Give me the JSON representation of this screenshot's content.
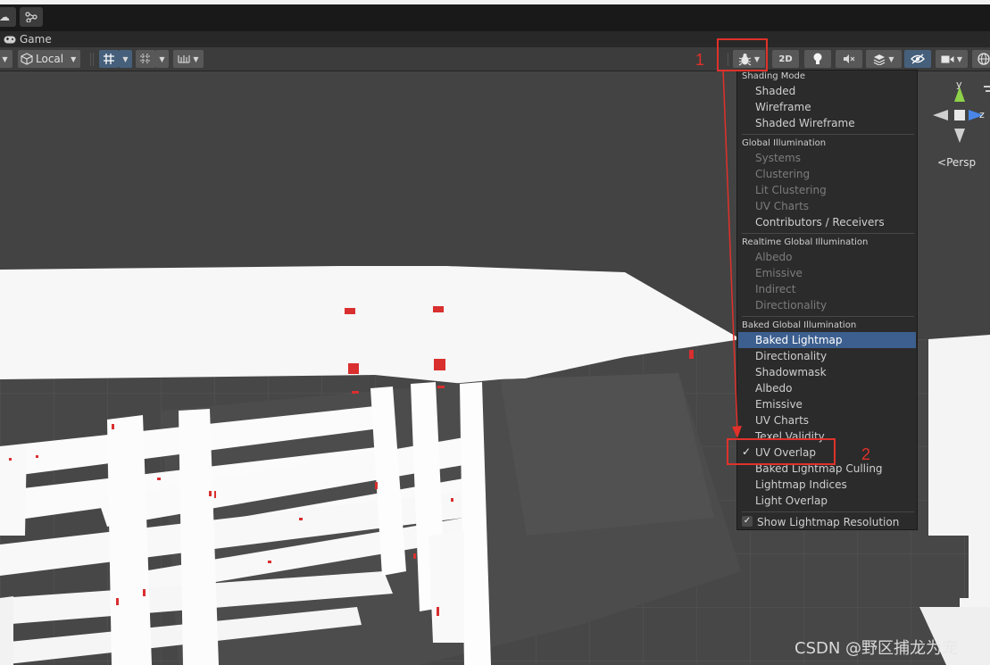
{
  "window": {
    "tab_label": "Game"
  },
  "toolbar": {
    "pivot_rotation": "Local",
    "twod_label": "2D"
  },
  "scene": {
    "projection_label": "Persp",
    "gizmo_axes": {
      "y": "y",
      "z": "z"
    }
  },
  "draw_mode_menu": {
    "sections": {
      "shading_mode": "Shading Mode",
      "global_illumination": "Global Illumination",
      "realtime_gi": "Realtime Global Illumination",
      "baked_gi": "Baked Global Illumination"
    },
    "shading_items": [
      "Shaded",
      "Wireframe",
      "Shaded Wireframe"
    ],
    "gi_items": [
      "Systems",
      "Clustering",
      "Lit Clustering",
      "UV Charts",
      "Contributors / Receivers"
    ],
    "realtime_items": [
      "Albedo",
      "Emissive",
      "Indirect",
      "Directionality"
    ],
    "baked_items": [
      "Baked Lightmap",
      "Directionality",
      "Shadowmask",
      "Albedo",
      "Emissive",
      "UV Charts",
      "Texel Validity",
      "UV Overlap",
      "Baked Lightmap Culling",
      "Lightmap Indices",
      "Light Overlap"
    ],
    "highlighted_item": "Baked Lightmap",
    "checked_item": "UV Overlap",
    "show_lightmap_resolution": "Show Lightmap Resolution"
  },
  "annotations": {
    "step1": "1",
    "step2": "2",
    "color": "#e0312a"
  },
  "watermark": "CSDN @野区捕龙为宠"
}
